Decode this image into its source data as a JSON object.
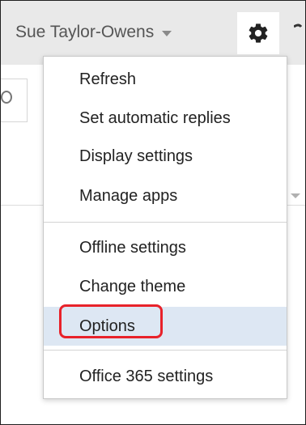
{
  "header": {
    "user_name": "Sue Taylor-Owens",
    "user_menu_caret_icon": "caret-down-icon",
    "settings_icon": "gear-icon"
  },
  "menu": {
    "items": [
      {
        "label": "Refresh"
      },
      {
        "label": "Set automatic replies"
      },
      {
        "label": "Display settings"
      },
      {
        "label": "Manage apps"
      },
      {
        "label": "Offline settings"
      },
      {
        "label": "Change theme"
      },
      {
        "label": "Options",
        "highlighted": true
      },
      {
        "label": "Office 365 settings"
      }
    ],
    "highlight_color": "#dde7f3",
    "callout_color": "#e8222a"
  }
}
